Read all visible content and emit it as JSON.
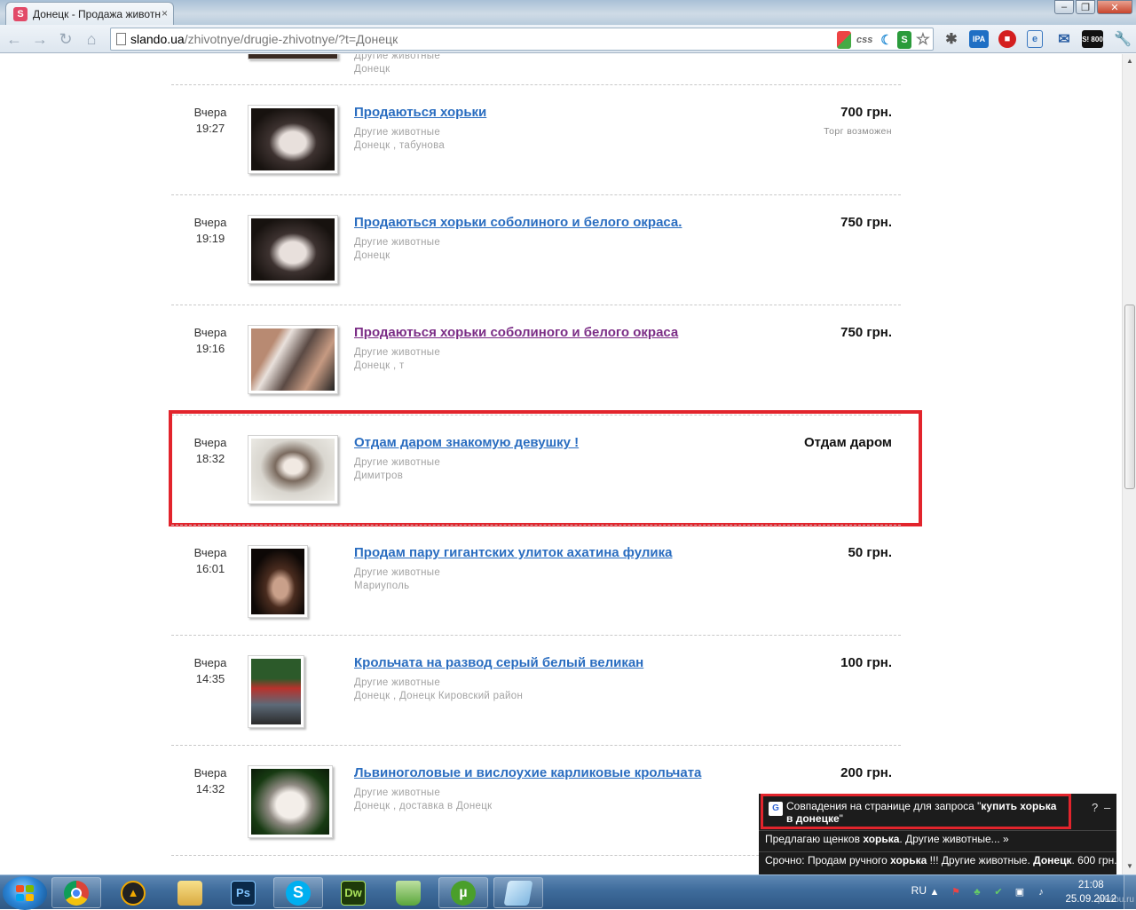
{
  "browser": {
    "tab_title": "Донецк - Продажа животн",
    "tab_favicon": "S",
    "url_host": "slando.ua",
    "url_path": "/zhivotnye/drugie-zhivotnye/?t=Донецк",
    "extensions": [
      "css",
      "S",
      "IPA",
      "S! 800"
    ]
  },
  "listings_partial": {
    "category": "Другие животные",
    "location": "Донецк"
  },
  "listings": [
    {
      "day": "Вчера",
      "time": "19:27",
      "title": "Продаються хорьки",
      "category": "Другие животные",
      "location": "Донецк , табунова",
      "price": "700 грн.",
      "price_note": "Торг возможен",
      "visited": false
    },
    {
      "day": "Вчера",
      "time": "19:19",
      "title": "Продаються хорьки соболиного и белого окраса.",
      "category": "Другие животные",
      "location": "Донецк",
      "price": "750 грн.",
      "price_note": "",
      "visited": false
    },
    {
      "day": "Вчера",
      "time": "19:16",
      "title": "Продаються хорьки соболиного и белого окраса",
      "category": "Другие животные",
      "location": "Донецк , т",
      "price": "750 грн.",
      "price_note": "",
      "visited": true
    },
    {
      "day": "Вчера",
      "time": "18:32",
      "title": "Отдам даром знакомую девушку !",
      "category": "Другие животные",
      "location": "Димитров",
      "price": "Отдам даром",
      "price_note": "",
      "visited": false
    },
    {
      "day": "Вчера",
      "time": "16:01",
      "title": "Продам пару гигантских улиток ахатина фулика",
      "category": "Другие животные",
      "location": "Мариуполь",
      "price": "50 грн.",
      "price_note": "",
      "visited": false
    },
    {
      "day": "Вчера",
      "time": "14:35",
      "title": "Крольчата на развод серый белый великан",
      "category": "Другие животные",
      "location": "Донецк , Донецк Кировский район",
      "price": "100 грн.",
      "price_note": "",
      "visited": false
    },
    {
      "day": "Вчера",
      "time": "14:32",
      "title": "Львиноголовые и вислоухие карликовые крольчата",
      "category": "Другие животные",
      "location": "Донецк , доставка в Донецк",
      "price": "200 грн.",
      "price_note": "",
      "visited": false
    }
  ],
  "notification": {
    "head_prefix": "Совпадения на странице для запроса \"",
    "head_query": "купить хорька в донецке",
    "head_suffix": "\"",
    "help": "?",
    "minimize": "–",
    "item1_pre": "Предлагаю щенков ",
    "item1_bold": "хорька",
    "item1_post": ". Другие животные... »",
    "item2_pre": "Срочно: Продам ручного ",
    "item2_bold1": "хорька",
    "item2_mid": " !!! Другие животные. ",
    "item2_bold2": "Донецк",
    "item2_post": ". 600 грн. »"
  },
  "taskbar": {
    "apps": [
      "chrome-icon",
      "aimp-icon",
      "explorer-icon",
      "photoshop-icon",
      "skype-icon",
      "dreamweaver-icon",
      "app-icon",
      "utorrent-icon",
      "notepad-icon"
    ],
    "ps_label": "Ps",
    "dw_label": "Dw",
    "lang": "RU",
    "time": "21:08",
    "date": "25.09.2012",
    "watermark": "pikabu.ru"
  },
  "colors": {
    "link": "#2a6dc0",
    "visited": "#7b2d86",
    "highlight": "#e2242c"
  }
}
